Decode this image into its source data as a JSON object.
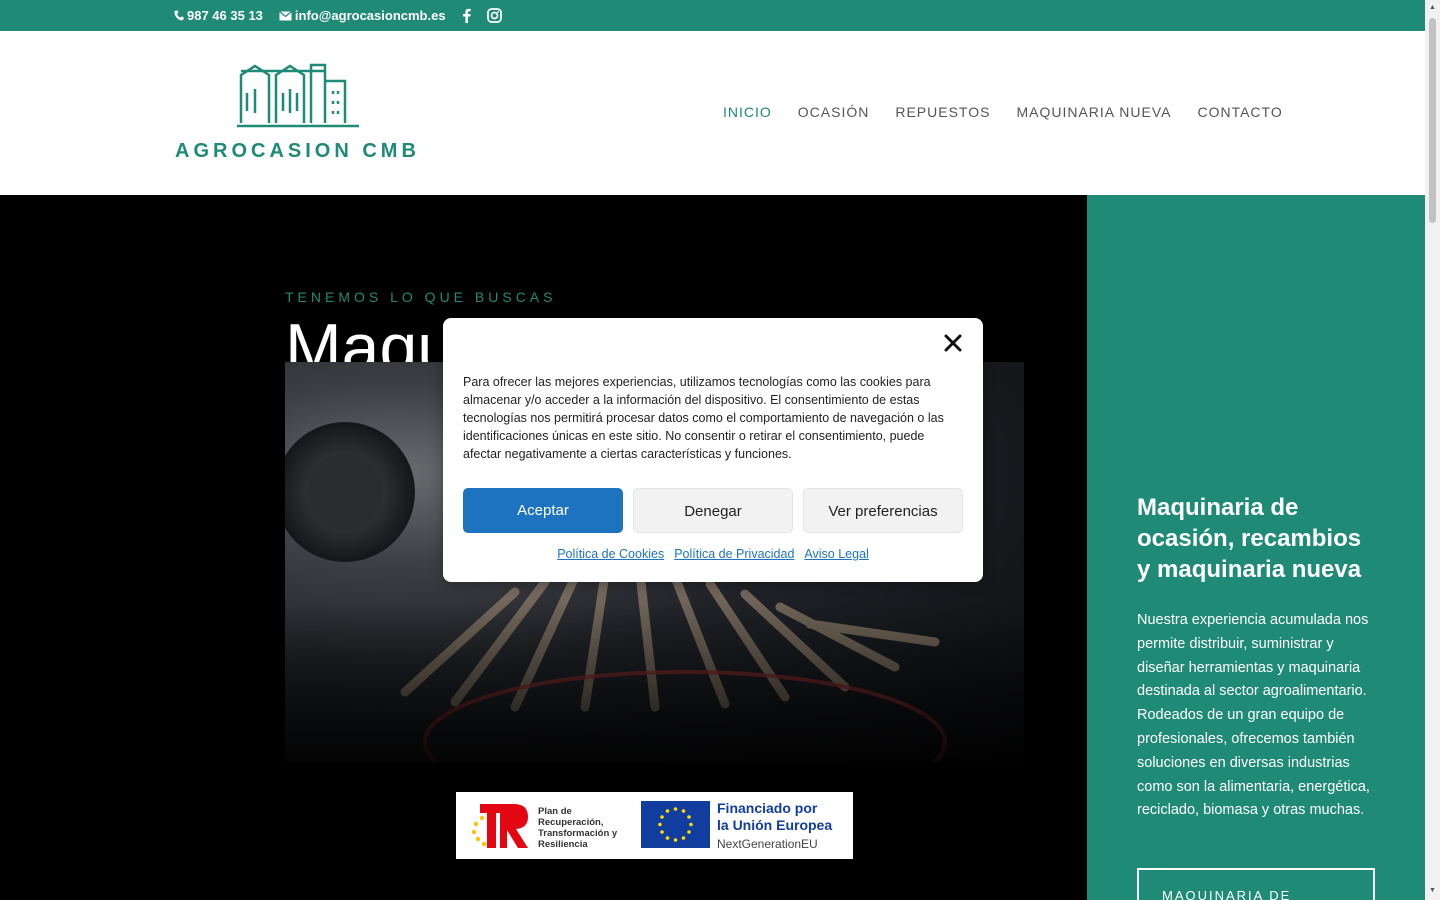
{
  "colors": {
    "brand": "#1f8a76",
    "accent_button": "#1e73be"
  },
  "topbar": {
    "phone": "987 46 35 13",
    "email": "info@agrocasioncmb.es",
    "icons": [
      "phone-icon",
      "email-icon",
      "facebook-icon",
      "instagram-icon"
    ]
  },
  "header": {
    "logo_text": "AGROCASION CMB",
    "nav": [
      {
        "label": "INICIO",
        "active": true
      },
      {
        "label": "OCASIÓN"
      },
      {
        "label": "REPUESTOS"
      },
      {
        "label": "MAQUINARIA NUEVA"
      },
      {
        "label": "CONTACTO"
      }
    ]
  },
  "hero": {
    "eyebrow": "TENEMOS LO QUE BUSCAS",
    "title_visible": "Maqu",
    "funding": {
      "plan_text": "Plan de Recuperación, Transformación y Resiliencia",
      "eu_line1": "Financiado por",
      "eu_line2": "la Unión Europea",
      "eu_line3": "NextGenerationEU"
    }
  },
  "sidebar": {
    "title": "Maquinaria de ocasión, recambios y maquinaria nueva",
    "body": "Nuestra experiencia acumulada nos permite distribuir, suministrar y diseñar herramientas y maquinaria destinada al sector agroalimentario. Rodeados de un gran equipo de profesionales, ofrecemos también soluciones en diversas industrias como son la alimentaria, energética, reciclado, biomasa y otras muchas.",
    "button_label": "MAQUINARIA DE"
  },
  "cookie_modal": {
    "text": "Para ofrecer las mejores experiencias, utilizamos tecnologías como las cookies para almacenar y/o acceder a la información del dispositivo. El consentimiento de estas tecnologías nos permitirá procesar datos como el comportamiento de navegación o las identificaciones únicas en este sitio. No consentir o retirar el consentimiento, puede afectar negativamente a ciertas características y funciones.",
    "accept_label": "Aceptar",
    "deny_label": "Denegar",
    "prefs_label": "Ver preferencias",
    "links": [
      "Política de Cookies",
      "Política de Privacidad",
      "Aviso Legal"
    ]
  }
}
